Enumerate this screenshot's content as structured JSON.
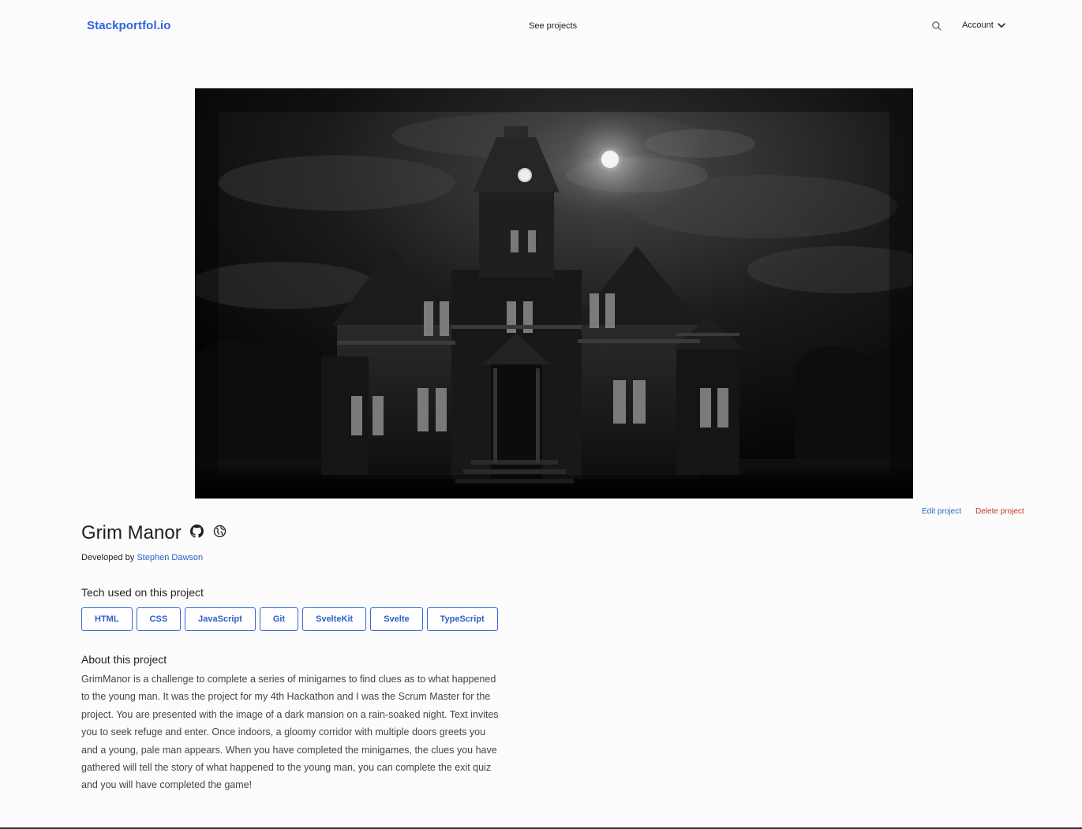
{
  "header": {
    "brand": "Stackportfol.io",
    "nav_center": "See projects",
    "account_label": "Account",
    "icons": {
      "search": "search-icon",
      "account_chevron": "chevron-down-icon"
    }
  },
  "hero": {
    "image": "haunted-mansion-image",
    "alt": "Dark gothic mansion under a full moon at night"
  },
  "actions": {
    "edit": "Edit project",
    "delete": "Delete project"
  },
  "project": {
    "title": "Grim Manor",
    "developed_by_prefix": "Developed by",
    "developer": "Stephen Dawson",
    "icons": [
      "github-icon",
      "globe-icon"
    ]
  },
  "tech": {
    "heading": "Tech used on this project",
    "items": [
      "HTML",
      "CSS",
      "JavaScript",
      "Git",
      "SvelteKit",
      "Svelte",
      "TypeScript"
    ]
  },
  "about": {
    "heading": "About this project",
    "text": "GrimManor is a challenge to complete a series of minigames to find clues as to what happened to the young man. It was the project for my 4th Hackathon and I was the Scrum Master for the project. You are presented with the image of a dark mansion on a rain-soaked night. Text invites you to seek refuge and enter. Once indoors, a gloomy corridor with multiple doors greets you and a young, pale man appears. When you have completed the minigames, the clues you have gathered will tell the story of what happened to the young man, you can complete the exit quiz and you will have completed the game!"
  },
  "colors": {
    "brand": "#2f63e0",
    "link": "#2f63c9",
    "danger": "#c4342c",
    "tag_border": "#3a67cf",
    "background": "#fcfcfc"
  }
}
